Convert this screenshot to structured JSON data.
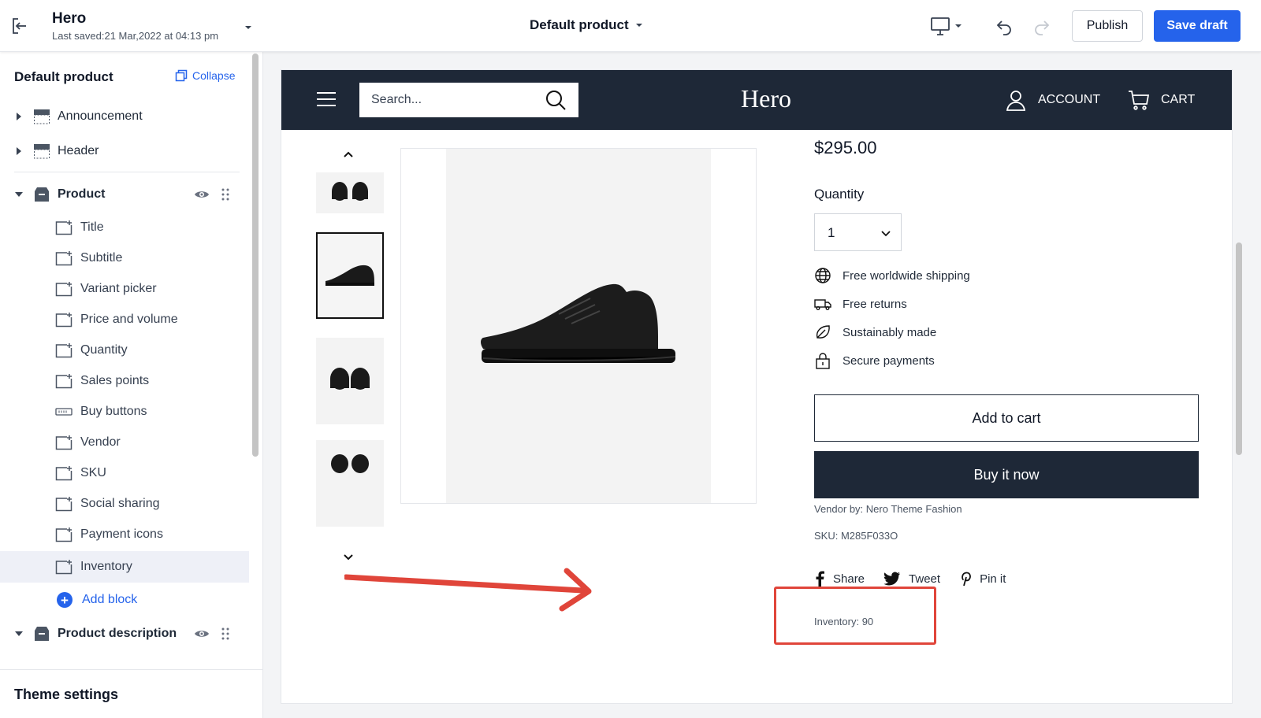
{
  "topbar": {
    "title": "Hero",
    "last_saved": "Last saved:21 Mar,2022 at 04:13 pm",
    "product_select": "Default product",
    "publish_label": "Publish",
    "save_label": "Save draft"
  },
  "sidebar": {
    "heading": "Default product",
    "collapse_label": "Collapse",
    "sections": [
      {
        "label": "Announcement",
        "icon": "section-layout-icon"
      },
      {
        "label": "Header",
        "icon": "section-layout-icon"
      },
      {
        "label": "Product",
        "icon": "product-box-icon"
      }
    ],
    "blocks": [
      {
        "label": "Title",
        "icon": "block-icon"
      },
      {
        "label": "Subtitle",
        "icon": "block-icon"
      },
      {
        "label": "Variant picker",
        "icon": "block-icon"
      },
      {
        "label": "Price and volume",
        "icon": "block-icon"
      },
      {
        "label": "Quantity",
        "icon": "block-icon"
      },
      {
        "label": "Sales points",
        "icon": "block-icon"
      },
      {
        "label": "Buy buttons",
        "icon": "btn-block-icon"
      },
      {
        "label": "Vendor",
        "icon": "block-icon"
      },
      {
        "label": "SKU",
        "icon": "block-icon"
      },
      {
        "label": "Social sharing",
        "icon": "block-icon"
      },
      {
        "label": "Payment icons",
        "icon": "block-icon"
      },
      {
        "label": "Inventory",
        "icon": "block-icon",
        "active": true
      }
    ],
    "add_block_label": "Add block",
    "product_description_label": "Product description",
    "theme_settings_label": "Theme settings"
  },
  "store": {
    "search_placeholder": "Search...",
    "brand": "Hero",
    "account_label": "ACCOUNT",
    "cart_label": "CART",
    "price": "$295.00",
    "quantity_label": "Quantity",
    "quantity_value": "1",
    "sales_points": [
      {
        "label": "Free worldwide shipping",
        "icon": "globe-icon"
      },
      {
        "label": "Free returns",
        "icon": "truck-icon"
      },
      {
        "label": "Sustainably made",
        "icon": "leaf-icon"
      },
      {
        "label": "Secure payments",
        "icon": "lock-icon"
      }
    ],
    "add_to_cart_label": "Add to cart",
    "buy_now_label": "Buy it now",
    "vendor_text": "Vendor by: Nero Theme Fashion",
    "sku_text": "SKU: M285F033O",
    "share_label": "Share",
    "tweet_label": "Tweet",
    "pin_label": "Pin it",
    "inventory_text": "Inventory: 90"
  },
  "colors": {
    "accent": "#2563eb",
    "store_header": "#1e2837",
    "annotation_red": "#e0453a"
  }
}
